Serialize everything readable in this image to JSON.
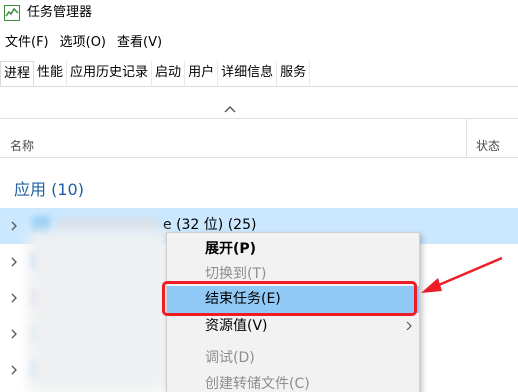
{
  "window": {
    "title": "任务管理器",
    "icon": "task-manager-icon"
  },
  "menubar": {
    "items": [
      "文件(F)",
      "选项(O)",
      "查看(V)"
    ]
  },
  "tabs": {
    "items": [
      "进程",
      "性能",
      "应用历史记录",
      "启动",
      "用户",
      "详细信息",
      "服务"
    ],
    "active": "进程"
  },
  "columns": {
    "name": "名称",
    "status": "状态"
  },
  "process_list": {
    "group_label": "应用 (10)",
    "first_row_visible_text": "e (32 位) (25)"
  },
  "context_menu": {
    "items": [
      {
        "label": "展开(P)",
        "state": "bold"
      },
      {
        "label": "切换到(T)",
        "state": "disabled"
      },
      {
        "label": "结束任务(E)",
        "state": "highlighted"
      },
      {
        "label": "资源值(V)",
        "state": "normal",
        "submenu": true
      },
      {
        "label": "调试(D)",
        "state": "disabled"
      },
      {
        "label": "创建转储文件(C)",
        "state": "disabled"
      }
    ]
  },
  "colors": {
    "selection": "#cce8ff",
    "menu_highlight": "#91c9f7",
    "group_header": "#1f5fa3",
    "annotation_red": "#ee1c25"
  }
}
